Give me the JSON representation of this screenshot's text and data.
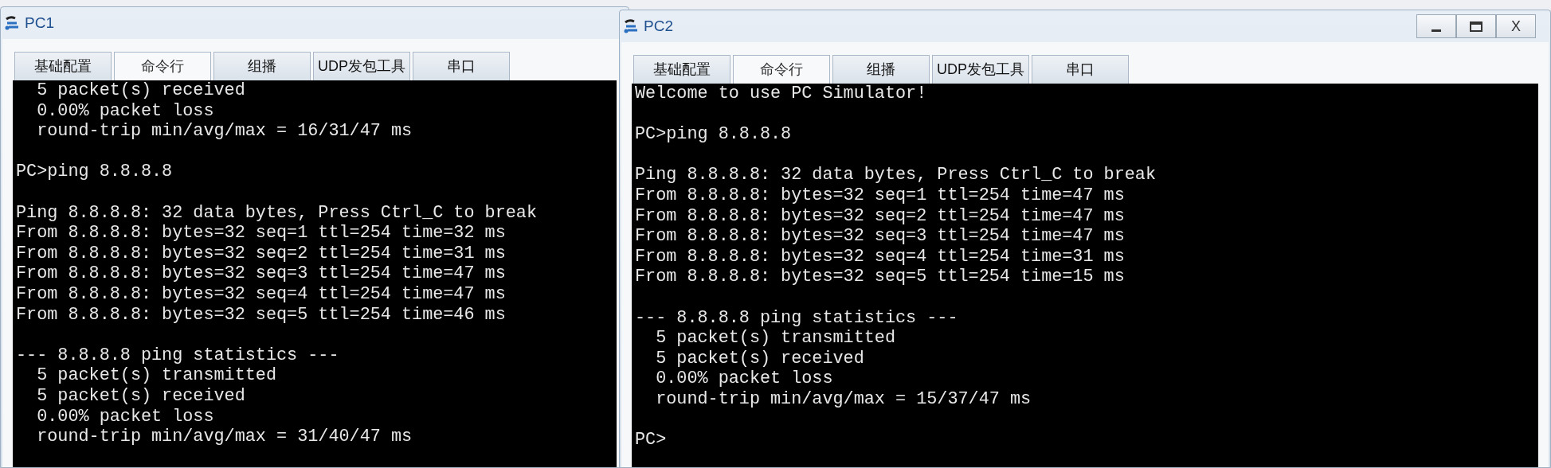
{
  "windows": [
    {
      "title": "PC1",
      "tabs": [
        {
          "label": "基础配置",
          "selected": false
        },
        {
          "label": "命令行",
          "selected": true
        },
        {
          "label": "组播",
          "selected": false
        },
        {
          "label": "UDP发包工具",
          "selected": false
        },
        {
          "label": "串口",
          "selected": false
        }
      ],
      "terminal_blocks": [
        [
          "  5 packet(s) received",
          "  0.00% packet loss",
          "  round-trip min/avg/max = 16/31/47 ms"
        ],
        [
          "PC>ping 8.8.8.8"
        ],
        [
          "Ping 8.8.8.8: 32 data bytes, Press Ctrl_C to break",
          "From 8.8.8.8: bytes=32 seq=1 ttl=254 time=32 ms",
          "From 8.8.8.8: bytes=32 seq=2 ttl=254 time=31 ms",
          "From 8.8.8.8: bytes=32 seq=3 ttl=254 time=47 ms",
          "From 8.8.8.8: bytes=32 seq=4 ttl=254 time=47 ms",
          "From 8.8.8.8: bytes=32 seq=5 ttl=254 time=46 ms"
        ],
        [
          "--- 8.8.8.8 ping statistics ---",
          "  5 packet(s) transmitted",
          "  5 packet(s) received",
          "  0.00% packet loss",
          "  round-trip min/avg/max = 31/40/47 ms"
        ]
      ]
    },
    {
      "title": "PC2",
      "window_buttons": [
        {
          "kind": "minimize"
        },
        {
          "kind": "maximize"
        },
        {
          "kind": "close",
          "label": "X"
        }
      ],
      "tabs": [
        {
          "label": "基础配置",
          "selected": false
        },
        {
          "label": "命令行",
          "selected": true
        },
        {
          "label": "组播",
          "selected": false
        },
        {
          "label": "UDP发包工具",
          "selected": false
        },
        {
          "label": "串口",
          "selected": false
        }
      ],
      "terminal_blocks": [
        [
          "Welcome to use PC Simulator!"
        ],
        [
          "PC>ping 8.8.8.8"
        ],
        [
          "Ping 8.8.8.8: 32 data bytes, Press Ctrl_C to break",
          "From 8.8.8.8: bytes=32 seq=1 ttl=254 time=47 ms",
          "From 8.8.8.8: bytes=32 seq=2 ttl=254 time=47 ms",
          "From 8.8.8.8: bytes=32 seq=3 ttl=254 time=47 ms",
          "From 8.8.8.8: bytes=32 seq=4 ttl=254 time=31 ms",
          "From 8.8.8.8: bytes=32 seq=5 ttl=254 time=15 ms"
        ],
        [
          "--- 8.8.8.8 ping statistics ---",
          "  5 packet(s) transmitted",
          "  5 packet(s) received",
          "  0.00% packet loss",
          "  round-trip min/avg/max = 15/37/47 ms"
        ],
        [
          "PC>"
        ]
      ]
    }
  ]
}
